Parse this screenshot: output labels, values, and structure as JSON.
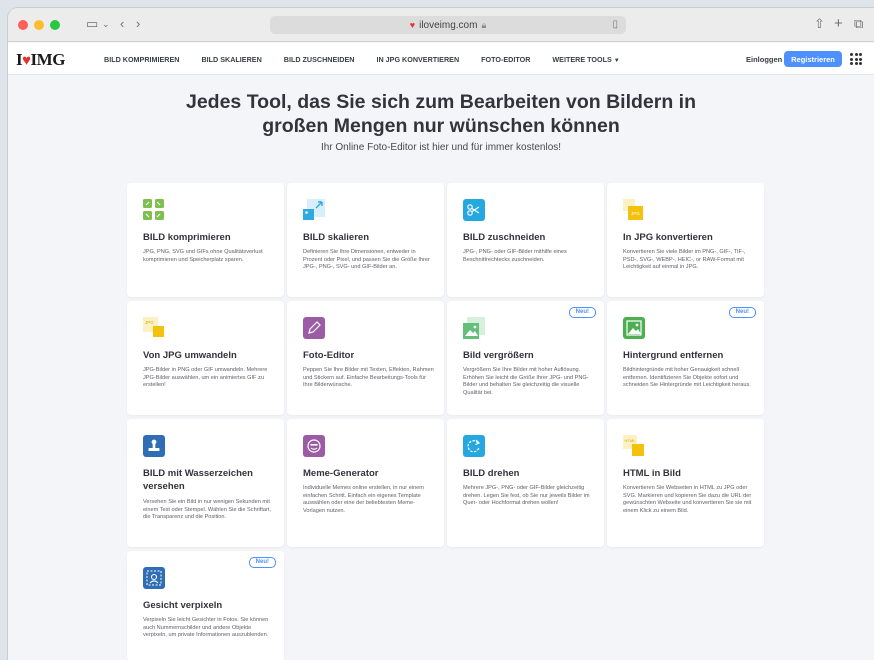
{
  "browser": {
    "url": "iloveimg.com",
    "traffic_colors": [
      "#fe5f57",
      "#febc2e",
      "#28c840"
    ]
  },
  "site": {
    "logo_left": "I",
    "logo_right": "IMG",
    "nav": [
      "BILD KOMPRIMIEREN",
      "BILD SKALIEREN",
      "BILD ZUSCHNEIDEN",
      "IN JPG KONVERTIEREN",
      "FOTO-EDITOR",
      "WEITERE TOOLS"
    ],
    "login": "Einloggen",
    "register": "Registrieren",
    "accent": "#4d90fe",
    "brand": "#e5322d"
  },
  "hero": {
    "title_line1": "Jedes Tool, das Sie sich zum Bearbeiten von Bildern in",
    "title_line2": "großen Mengen nur wünschen können",
    "subtitle": "Ihr Online Foto-Editor ist hier und für immer kostenlos!"
  },
  "cards": [
    {
      "title": "BILD komprimieren",
      "desc": "JPG, PNG, SVG und GIFs ohne Qualitätsverlust komprimieren und Speicherplatz sparen.",
      "icon": "compress-icon",
      "color": "#7fbf4d",
      "badge": ""
    },
    {
      "title": "BILD skalieren",
      "desc": "Definieren Sie Ihre Dimensionen, entweder in Prozent oder Pixel, und passen Sie die Größe Ihrer JPG-, PNG-, SVG- und GIF-Bilder an.",
      "icon": "resize-icon",
      "color": "#2fa9e0",
      "badge": ""
    },
    {
      "title": "BILD zuschneiden",
      "desc": "JPG-, PNG- oder GIF-Bilder mithilfe eines Beschnittrechtecks zuschneiden.",
      "icon": "crop-icon",
      "color": "#25a8e0",
      "badge": ""
    },
    {
      "title": "In JPG konvertieren",
      "desc": "Konvertieren Sie viele Bilder im PNG-, GIF-, TIF-, PSD-, SVG-, WEBP-, HEIC-, or RAW-Format mit Leichtigkeit auf einmal in JPG.",
      "icon": "to-jpg-icon",
      "color": "#f4c20d",
      "badge": ""
    },
    {
      "title": "Von JPG umwandeln",
      "desc": "JPG-Bilder in PNG oder GIF umwandeln. Mehrere JPG-Bilder auswählen, um ein animiertes GIF zu erstellen!",
      "icon": "from-jpg-icon",
      "color": "#f4c20d",
      "badge": ""
    },
    {
      "title": "Foto-Editor",
      "desc": "Peppen Sie Ihre Bilder mit Texten, Effekten, Rahmen und Stickern auf. Einfache Bearbeitungs-Tools für Ihre Bilderwünsche.",
      "icon": "pencil-icon",
      "color": "#9b5ba5",
      "badge": ""
    },
    {
      "title": "Bild vergrößern",
      "desc": "Vergrößern Sie Ihre Bilder mit hoher Auflösung. Erhöhen Sie leicht die Größe Ihrer JPG- und PNG-Bilder und behalten Sie gleichzeitig die visuelle Qualität bei.",
      "icon": "upscale-icon",
      "color": "#62c07a",
      "badge": "Neu!"
    },
    {
      "title": "Hintergrund entfernen",
      "desc": "Bildhintergründe mit hoher Genauigkeit schnell entfernen. Identifizieren Sie Objekte sofort und schneiden Sie Hintergründe mit Leichtigkeit heraus.",
      "icon": "remove-bg-icon",
      "color": "#4caf50",
      "badge": "Neu!"
    },
    {
      "title": "BILD mit Wasserzeichen versehen",
      "desc": "Versehen Sie ein Bild in nur wenigen Sekunden mit einem Text oder Stempel. Wählen Sie die Schriftart, die Transparenz und die Position.",
      "icon": "stamp-icon",
      "color": "#2f6eb5",
      "badge": ""
    },
    {
      "title": "Meme-Generator",
      "desc": "Individuelle Memes online erstellen, in nur einem einfachen Schritt. Einfach ein eigenes Template auswählen oder eine der beliebtesten Meme-Vorlagen nutzen.",
      "icon": "meme-icon",
      "color": "#9b5ba5",
      "badge": ""
    },
    {
      "title": "BILD drehen",
      "desc": "Mehrere JPG-, PNG- oder GIF-Bilder gleichzeitig drehen. Legen Sie fest, ob Sie nur jeweils Bilder im Quer- oder Hochformat drehen wollen!",
      "icon": "rotate-icon",
      "color": "#25a8e0",
      "badge": ""
    },
    {
      "title": "HTML in Bild",
      "desc": "Konvertieren Sie Webseiten in HTML zu JPG oder SVG. Markieren und kopieren Sie dazu die URL der gewünschten Webseite und konvertieren Sie sie mit einem Klick zu einem Bild.",
      "icon": "html-icon",
      "color": "#f4c20d",
      "badge": ""
    },
    {
      "title": "Gesicht verpixeln",
      "desc": "Verpixeln Sie leicht Gesichter in Fotos. Sie können auch Nummernschilder und andere Objekte verpixeln, um private Informationen auszublenden.",
      "icon": "blur-face-icon",
      "color": "#2f6eb5",
      "badge": "Neu!"
    }
  ]
}
